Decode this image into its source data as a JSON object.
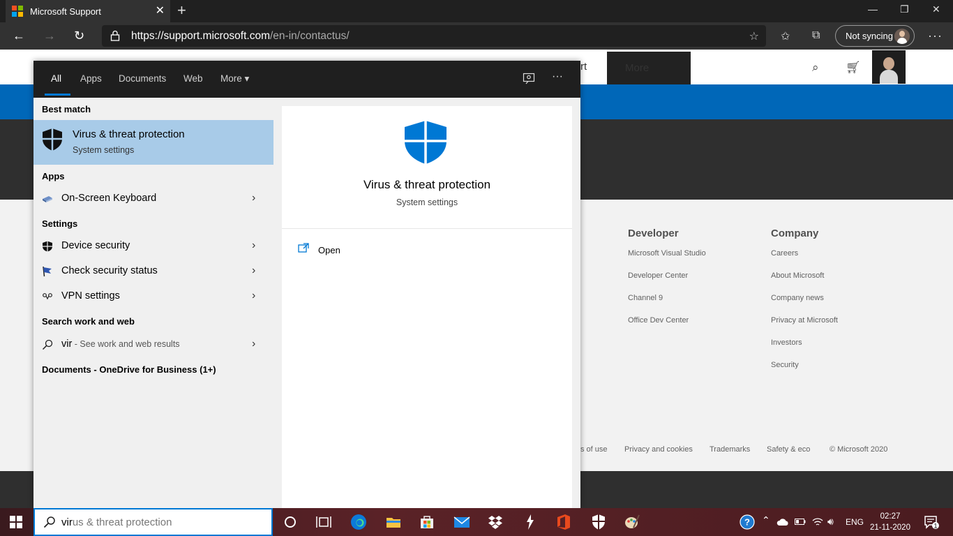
{
  "browser": {
    "tab_title": "Microsoft Support",
    "tab_close": "✕",
    "new_tab": "+",
    "url_host": "https://support.microsoft.com",
    "url_path": "/en-in/contactus/",
    "sync_label": "Not syncing",
    "more_label": "···",
    "nav": {
      "back": "←",
      "forward": "→",
      "refresh": "↻"
    }
  },
  "window_controls": {
    "minimize": "—",
    "restore": "❐",
    "close": "✕"
  },
  "site": {
    "header_partial": "rt",
    "header_more": "More",
    "footer": {
      "developer": {
        "title": "Developer",
        "links": [
          "Microsoft Visual Studio",
          "Developer Center",
          "Channel 9",
          "Office Dev Center"
        ]
      },
      "company": {
        "title": "Company",
        "links": [
          "Careers",
          "About Microsoft",
          "Company news",
          "Privacy at Microsoft",
          "Investors",
          "Security"
        ]
      },
      "legal": [
        "s of use",
        "Privacy and cookies",
        "Trademarks",
        "Safety & eco",
        "© Microsoft 2020"
      ]
    }
  },
  "search": {
    "tabs": [
      "All",
      "Apps",
      "Documents",
      "Web",
      "More ▾"
    ],
    "active_tab": "All",
    "best_match_label": "Best match",
    "best_match": {
      "title": "Virus & threat protection",
      "subtitle": "System settings",
      "icon": "shield-icon"
    },
    "apps_label": "Apps",
    "apps": [
      {
        "label": "On-Screen Keyboard",
        "icon": "keyboard-icon"
      }
    ],
    "settings_label": "Settings",
    "settings": [
      {
        "label": "Device security",
        "icon": "shield-icon"
      },
      {
        "label": "Check security status",
        "icon": "flag-icon"
      },
      {
        "label": "VPN settings",
        "icon": "vpn-icon"
      }
    ],
    "web_label": "Search work and web",
    "web": {
      "query": "vir",
      "suffix": " - See work and web results"
    },
    "documents_label": "Documents - OneDrive for Business (1+)",
    "preview": {
      "title": "Virus & threat protection",
      "subtitle": "System settings",
      "action": "Open"
    },
    "query_typed": "vir",
    "query_suggestion": "us & threat protection"
  },
  "taskbar": {
    "tray": {
      "language": "ENG"
    },
    "clock": {
      "time": "02:27",
      "date": "21-11-2020"
    },
    "notification_count": "1"
  },
  "colors": {
    "accent": "#0078d4",
    "best_match_bg": "#a8cbe8",
    "shield_blue": "#0078d4",
    "ms_blue_band": "#0067b8"
  }
}
